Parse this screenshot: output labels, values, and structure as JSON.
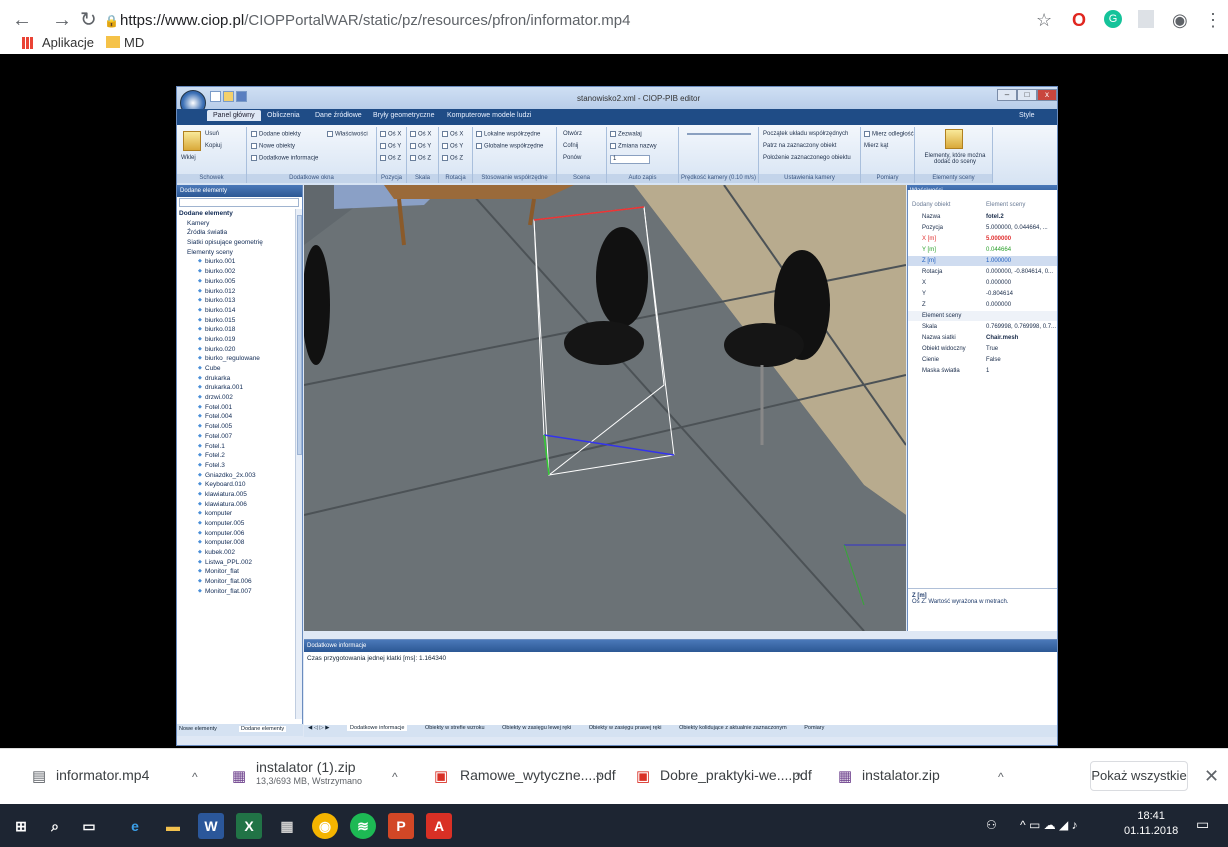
{
  "browser": {
    "url_host": "https://www.ciop.pl",
    "url_path": "/CIOPPortalWAR/static/pz/resources/pfron/informator.mp4",
    "bookmarks": [
      "Aplikacje",
      "MD"
    ]
  },
  "app": {
    "title": "stanowisko2.xml - CIOP-PIB editor",
    "style_label": "Style",
    "tabs": [
      "Panel główny",
      "Obliczenia",
      "Dane źródłowe",
      "Bryły geometryczne",
      "Komputerowe modele ludzi"
    ],
    "groups": [
      "Schowek",
      "Dodatkowe okna",
      "Pozycja",
      "Skala",
      "Rotacja",
      "Stosowanie współrzędne",
      "Scena",
      "Auto zapis",
      "Prędkość kamery (0.10 m/s)",
      "Ustawienia kamery",
      "Pomiary",
      "Elementy sceny"
    ],
    "clipboard": [
      "Usuń",
      "Kopiuj",
      "Wklej"
    ],
    "windows": [
      "Dodane obiekty",
      "Nowe obiekty",
      "Dodatkowe informacje",
      "Właściwości"
    ],
    "axes": [
      "Oś X",
      "Oś Y",
      "Oś Z"
    ],
    "coords": [
      "Lokalne współrzędne",
      "Globalne współrzędne"
    ],
    "scene": [
      "Otwórz",
      "Cofnij",
      "Ponów"
    ],
    "autosave": [
      "Zezwalaj",
      "Zmiana nazwy",
      "1"
    ],
    "camera": [
      "Początek układu współrzędnych",
      "Patrz na zaznaczony obiekt",
      "Położenie zaznaczonego obiektu"
    ],
    "measure": [
      "Mierz odległość",
      "Mierz kąt"
    ],
    "elements_label": "Elementy, które można dodać do sceny"
  },
  "left_panel": {
    "title": "Dodane elementy",
    "root": "Dodane elementy",
    "categories": [
      "Kamery",
      "Źródła światła",
      "Siatki opisujące geometrię",
      "Elementy sceny"
    ],
    "items": [
      "biurko.001",
      "biurko.002",
      "biurko.005",
      "biurko.012",
      "biurko.013",
      "biurko.014",
      "biurko.015",
      "biurko.018",
      "biurko.019",
      "biurko.020",
      "biurko_regulowane",
      "Cube",
      "drukarka",
      "drukarka.001",
      "drzwi.002",
      "Fotel.001",
      "Fotel.004",
      "Fotel.005",
      "Fotel.007",
      "Fotel.1",
      "Fotel.2",
      "Fotel.3",
      "Gniazdko_2x.003",
      "Keyboard.010",
      "klawiatura.005",
      "klawiatura.006",
      "komputer",
      "komputer.005",
      "komputer.006",
      "komputer.008",
      "kubek.002",
      "Listwa_PPL.002",
      "Monitor_flat",
      "Monitor_flat.006",
      "Monitor_flat.007"
    ],
    "bottom_tabs": [
      "Nowe elementy",
      "Dodane elementy"
    ]
  },
  "right_panel": {
    "title": "Właściwości",
    "col1": "Dodany obiekt",
    "col2": "Element sceny",
    "rows": [
      {
        "k": "Nazwa",
        "v": "fotel.2"
      },
      {
        "k": "Pozycja",
        "v": "5.000000, 0.044664, ..."
      },
      {
        "k": "X [m]",
        "v": "5.000000"
      },
      {
        "k": "Y [m]",
        "v": "0.044664"
      },
      {
        "k": "Z [m]",
        "v": "1.000000"
      },
      {
        "k": "Rotacja",
        "v": "0.000000, -0.804614, 0..."
      },
      {
        "k": "X",
        "v": "0.000000"
      },
      {
        "k": "Y",
        "v": "-0.804614"
      },
      {
        "k": "Z",
        "v": "0.000000"
      },
      {
        "k": "Element sceny",
        "v": ""
      },
      {
        "k": "Skala",
        "v": "0.769998, 0.769998, 0.7..."
      },
      {
        "k": "Nazwa siatki",
        "v": "Chair.mesh"
      },
      {
        "k": "Obiekt widoczny",
        "v": "True"
      },
      {
        "k": "Cienie",
        "v": "False"
      },
      {
        "k": "Maska światła",
        "v": "1"
      }
    ],
    "help_title": "Z [m]",
    "help_text": "Oś Z. Wartość wyrażona w metrach."
  },
  "bottom_panel": {
    "title": "Dodatkowe informacje",
    "text": "Czas przygotowania jednej klatki [ms]: 1.164340",
    "tabs": [
      "Dodatkowe informacje",
      "Obiekty w strefie wzroku",
      "Obiekty w zasięgu lewej ręki",
      "Obiekty w zasięgu prawej ręki",
      "Obiekty kolidujące z aktualnie zaznaczonym",
      "Pomiary"
    ]
  },
  "downloads": [
    {
      "name": "informator.mp4",
      "sub": ""
    },
    {
      "name": "instalator (1).zip",
      "sub": "13,3/693 MB, Wstrzymano"
    },
    {
      "name": "Ramowe_wytyczne....pdf",
      "sub": ""
    },
    {
      "name": "Dobre_praktyki-we....pdf",
      "sub": ""
    },
    {
      "name": "instalator.zip",
      "sub": ""
    }
  ],
  "show_all": "Pokaż wszystkie",
  "clock": {
    "time": "18:41",
    "date": "01.11.2018"
  }
}
